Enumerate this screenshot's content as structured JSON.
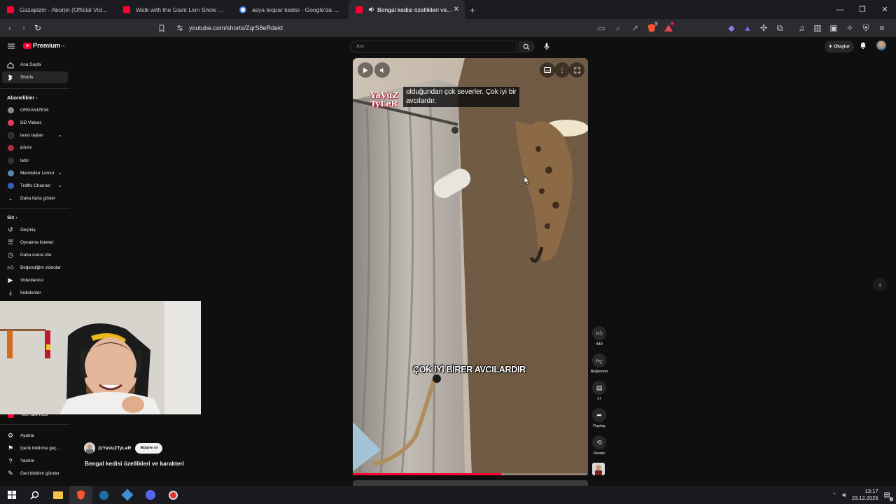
{
  "tabs": [
    {
      "label": "Gazapizm - Aborjin (Official Video) -",
      "icon": "youtube-icon",
      "color": "#ff0033"
    },
    {
      "label": "Walk with the Giant Lion Snow - Dea",
      "icon": "youtube-icon",
      "color": "#ff0033"
    },
    {
      "label": "asya leopar kedisi - Google'da Ara",
      "icon": "google-icon",
      "color": "#4285f4"
    },
    {
      "label": "Bengal kedisi özellikleri ve ka",
      "icon": "youtube-icon",
      "color": "#ff0033"
    }
  ],
  "address": {
    "url": "youtube.com/shorts/ZqrS8eRdekI"
  },
  "brave_badge": "5",
  "header": {
    "logo": "Premium",
    "logo_sup": "TR",
    "search_placeholder": "Ara",
    "create_label": "Oluştur"
  },
  "sidebar": {
    "nav": [
      {
        "label": "Ana Sayfa"
      },
      {
        "label": "Shorts"
      }
    ],
    "subs_title": "Abonelikler",
    "channels": [
      {
        "label": "ORGANIZE34",
        "color": "#777"
      },
      {
        "label": "DD Videos",
        "color": "#e83a5a"
      },
      {
        "label": "testo taylan",
        "color": "#1d1d1d"
      },
      {
        "label": "ERAY",
        "color": "#b03040"
      },
      {
        "label": "ladır",
        "color": "#333"
      },
      {
        "label": "Mendebur Lemur",
        "color": "#5588aa"
      },
      {
        "label": "Traffic Channel",
        "color": "#3060c0"
      }
    ],
    "show_more": "Daha fazla göster",
    "you_title": "Siz",
    "you_items": [
      {
        "label": "Geçmiş"
      },
      {
        "label": "Oynatma listeleri"
      },
      {
        "label": "Daha sonra izle"
      },
      {
        "label": "Beğendiğim videolar"
      },
      {
        "label": "Videolarınız"
      },
      {
        "label": "İndirilenler"
      }
    ],
    "kids": "YouTube Kids",
    "bottom": [
      {
        "label": "Ayarlar"
      },
      {
        "label": "İçerik bildirme geç..."
      },
      {
        "label": "Yardım"
      },
      {
        "label": "Geri bildirim gönder"
      }
    ]
  },
  "video": {
    "subtitle_line1": "olduğundan çok severler. Çok iyi bir",
    "subtitle_line2": "avcılardır.",
    "watermark_1": "YaVuZ",
    "watermark_2": "TyLeR",
    "caption": "ÇOK İYİ BİRER AVCILARDIR",
    "progress": 0.63
  },
  "actions": {
    "likes": "449",
    "dislike_label": "Beğenme",
    "comments": "17",
    "share_label": "Paylaş",
    "remix_label": "Remix"
  },
  "channel": {
    "name": "@YaVuZTyLeR",
    "subscribe_label": "Abone ol"
  },
  "video_title": "Bengal kedisi özellikleri ve karakteri",
  "taskbar": {
    "time": "13:17",
    "date": "23.12.2025",
    "notif_count": "3"
  }
}
